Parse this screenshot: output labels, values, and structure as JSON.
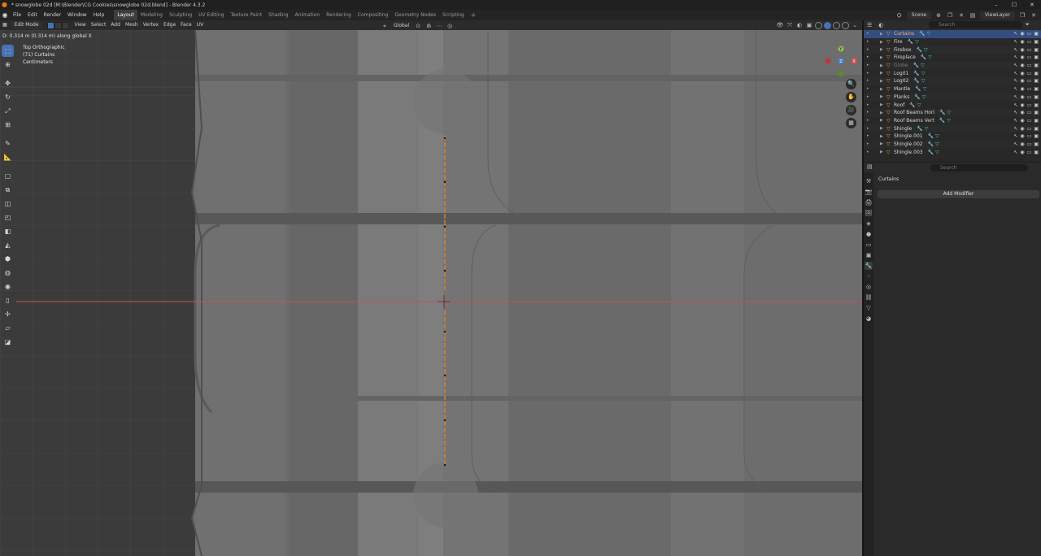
{
  "window": {
    "title": "* snowglobe 02d [M:\\Blender\\CG Cookies\\snowglobe 02d.blend] - Blender 4.3.2",
    "controls": [
      "–",
      "☐",
      "✕"
    ]
  },
  "menubar": {
    "menus": [
      "File",
      "Edit",
      "Render",
      "Window",
      "Help"
    ],
    "workspaces": [
      "Layout",
      "Modeling",
      "Sculpting",
      "UV Editing",
      "Texture Paint",
      "Shading",
      "Animation",
      "Rendering",
      "Compositing",
      "Geometry Nodes",
      "Scripting"
    ],
    "active_workspace": "Layout",
    "scene": "Scene",
    "view_layer": "ViewLayer"
  },
  "viewport_header": {
    "mode": "Edit Mode",
    "menus": [
      "View",
      "Select",
      "Add",
      "Mesh",
      "Vertex",
      "Edge",
      "Face",
      "UV"
    ],
    "orientation": "Global"
  },
  "status_line": "D: 0.314 m (0.314 m) along global X",
  "viewport_info": {
    "view": "Top Orthographic",
    "object": "(71) Curtains",
    "units": "Centimeters"
  },
  "outliner": {
    "search_placeholder": "Search",
    "rows": [
      {
        "name": "Curtains",
        "selected": true,
        "dim": false
      },
      {
        "name": "Fire",
        "selected": false,
        "dim": false
      },
      {
        "name": "Firebox",
        "selected": false,
        "dim": false
      },
      {
        "name": "Fireplace",
        "selected": false,
        "dim": false
      },
      {
        "name": "Globe",
        "selected": false,
        "dim": true
      },
      {
        "name": "Log01",
        "selected": false,
        "dim": false
      },
      {
        "name": "Log02",
        "selected": false,
        "dim": false
      },
      {
        "name": "Mantle",
        "selected": false,
        "dim": false
      },
      {
        "name": "Planks",
        "selected": false,
        "dim": false
      },
      {
        "name": "Roof",
        "selected": false,
        "dim": false
      },
      {
        "name": "Roof Beams Hori",
        "selected": false,
        "dim": false
      },
      {
        "name": "Roof Beams Vert",
        "selected": false,
        "dim": false
      },
      {
        "name": "Shingle",
        "selected": false,
        "dim": false
      },
      {
        "name": "Shingle.001",
        "selected": false,
        "dim": false
      },
      {
        "name": "Shingle.002",
        "selected": false,
        "dim": false
      },
      {
        "name": "Shingle.003",
        "selected": false,
        "dim": false
      }
    ]
  },
  "properties": {
    "search_placeholder": "Search",
    "object_name": "Curtains",
    "add_modifier": "Add Modifier"
  },
  "colors": {
    "accent": "#4772b3",
    "selected_text": "#ffb45a",
    "edge_select": "#e8882a",
    "x_axis": "#c8505a"
  }
}
